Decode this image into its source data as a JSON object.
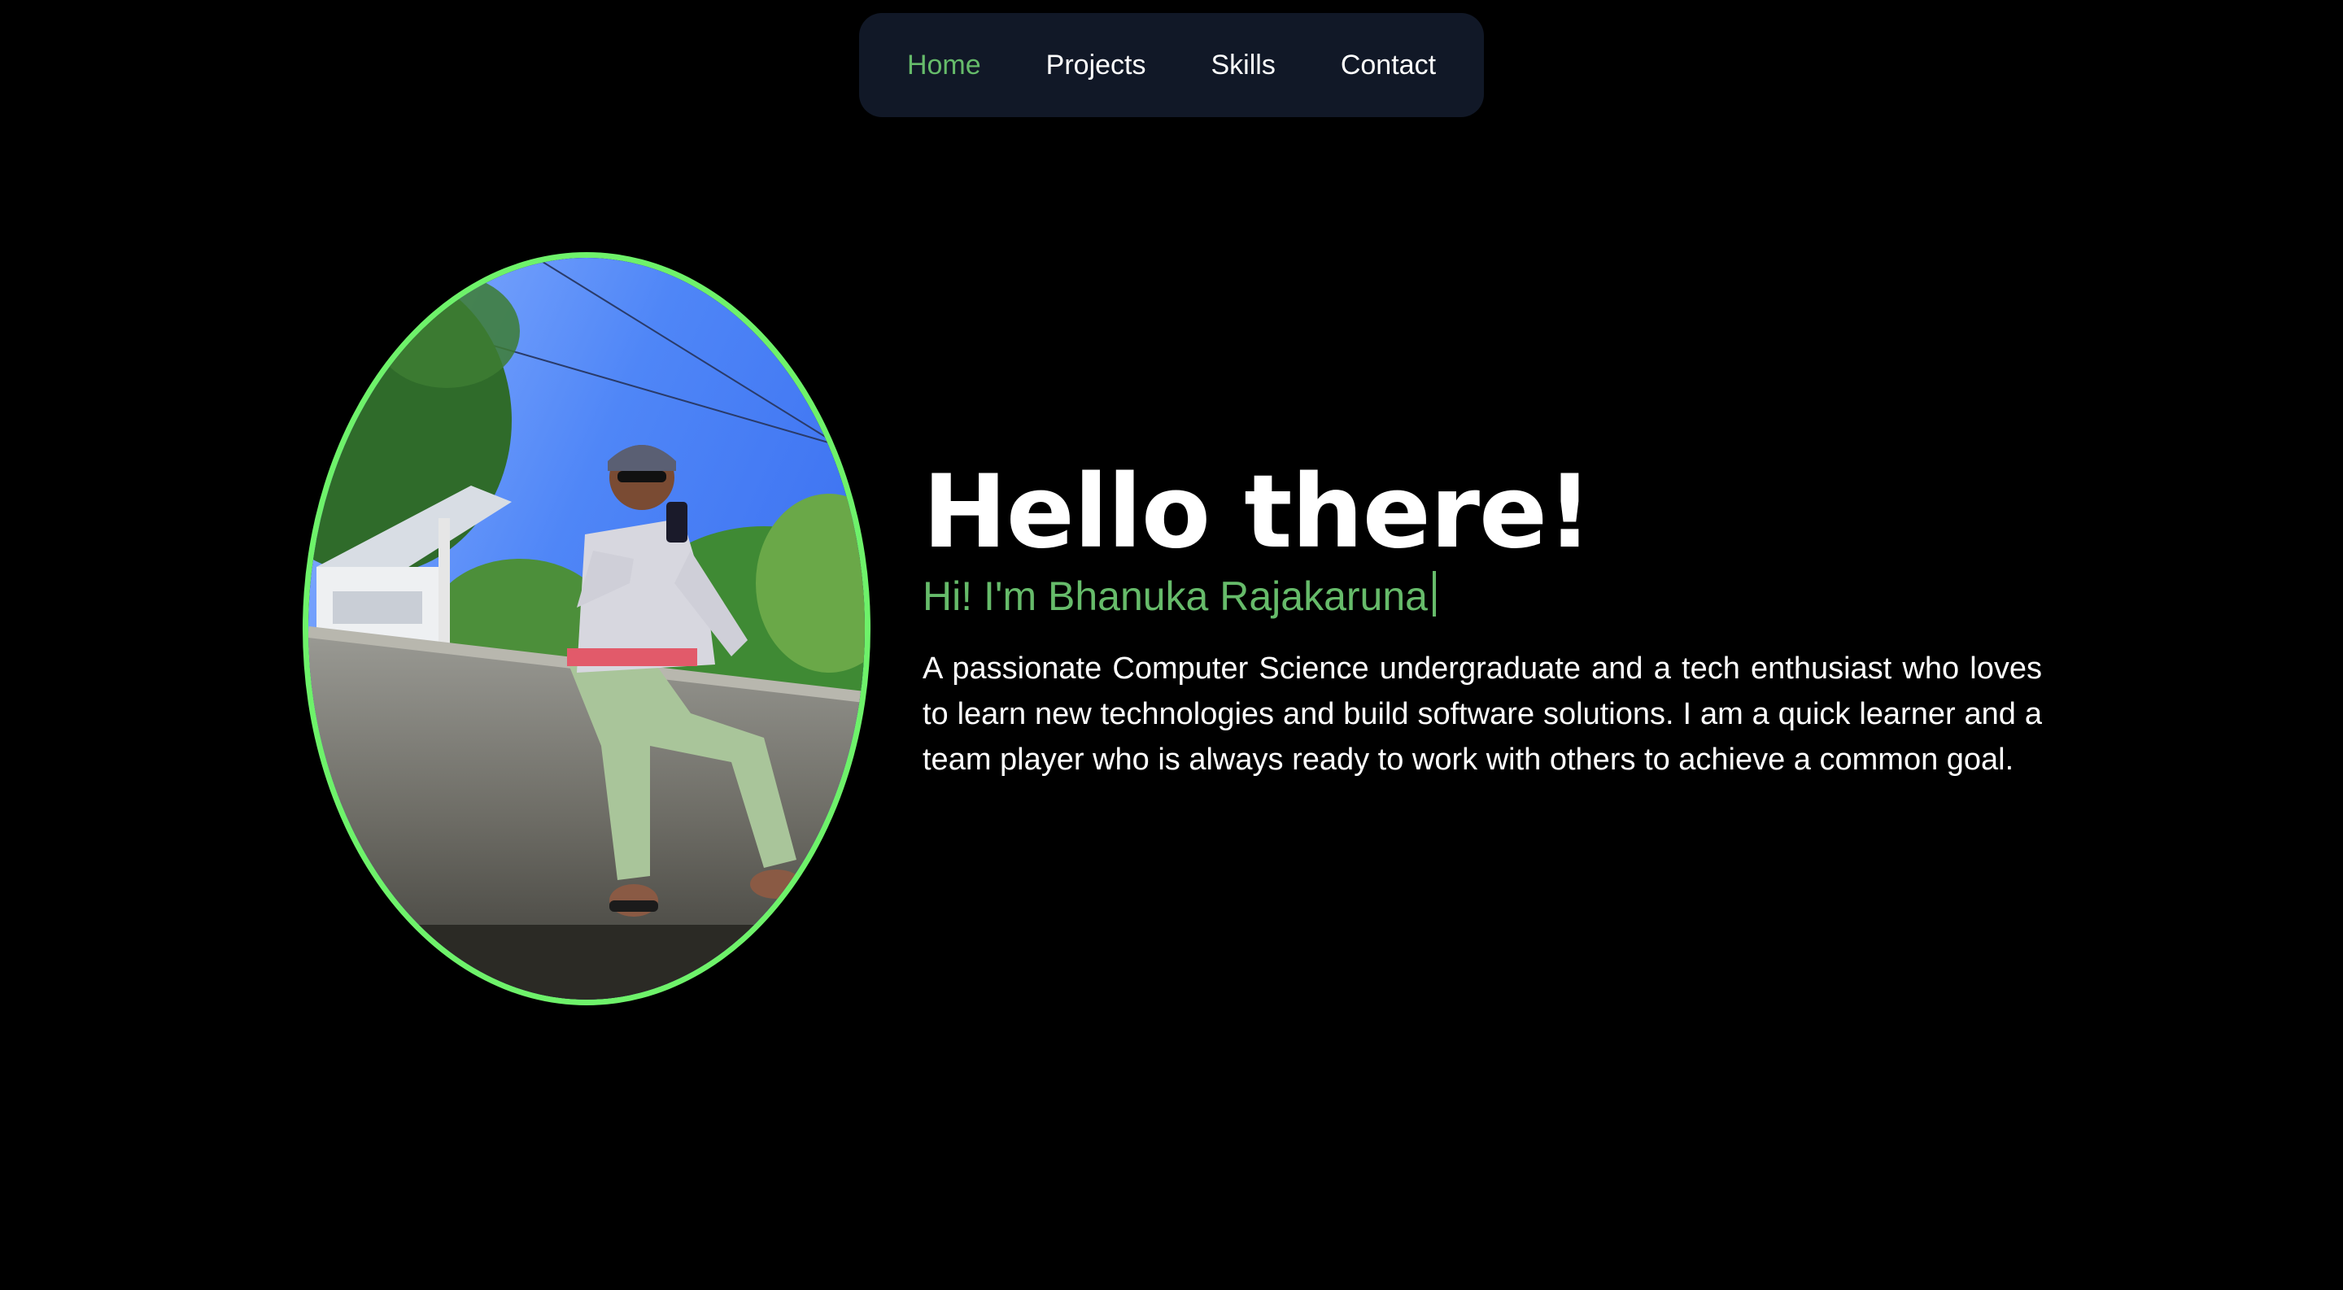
{
  "nav": {
    "items": [
      {
        "label": "Home",
        "active": true
      },
      {
        "label": "Projects",
        "active": false
      },
      {
        "label": "Skills",
        "active": false
      },
      {
        "label": "Contact",
        "active": false
      }
    ]
  },
  "hero": {
    "heading": "Hello there!",
    "subtitle": "Hi! I'm Bhanuka Rajakaruna",
    "description": "A passionate Computer Science undergraduate and a tech enthusiast who loves to learn new technologies and build software solutions. I am a quick learner and a team player who is always ready to work with others to achieve a common goal."
  },
  "colors": {
    "background": "#000000",
    "nav_background": "#111827",
    "accent": "#66bb6a",
    "portrait_border": "#6ef26a",
    "text": "#ffffff"
  }
}
